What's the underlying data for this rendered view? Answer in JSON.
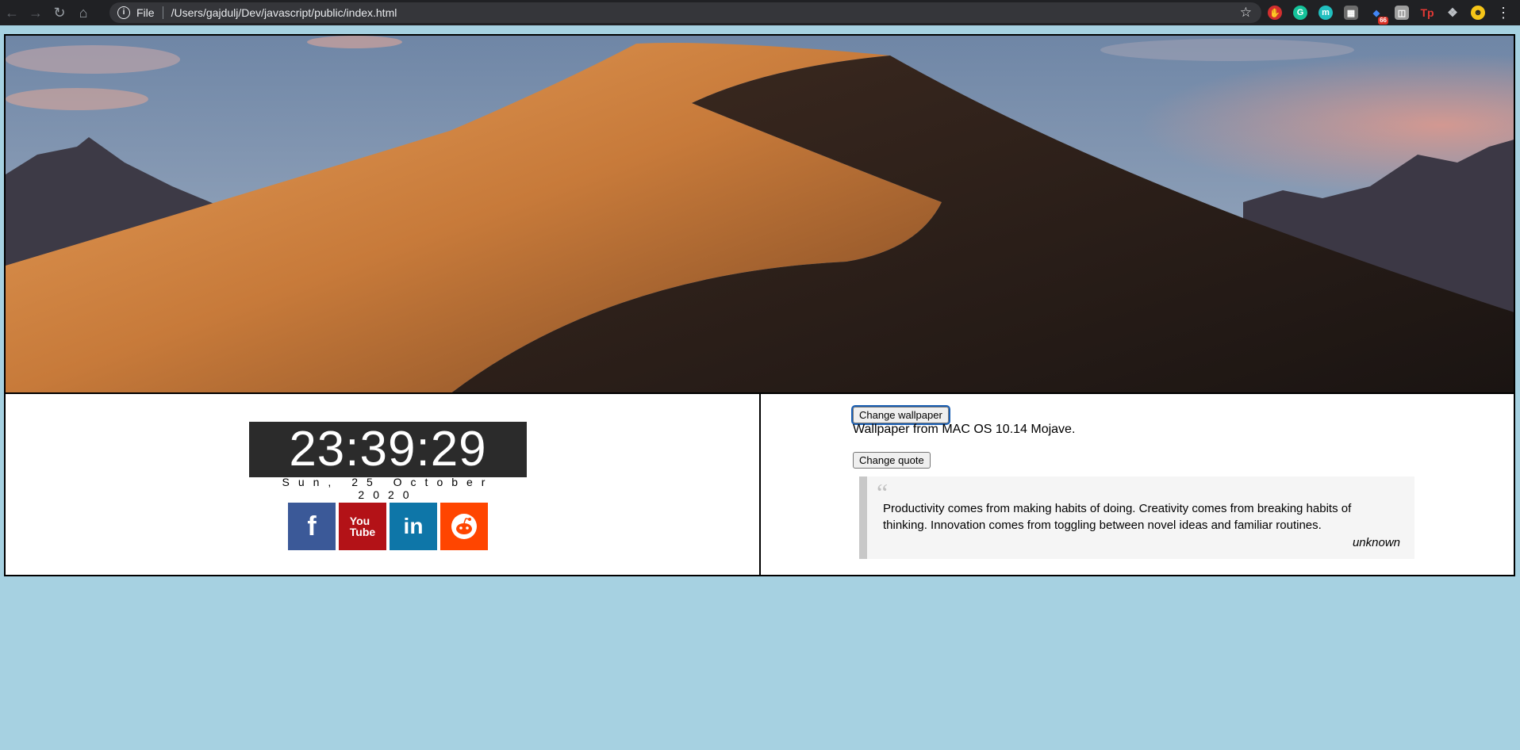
{
  "browser": {
    "file_label": "File",
    "url": "/Users/gajdulj/Dev/javascript/public/index.html",
    "extension_badge": "66"
  },
  "clock": {
    "time": "23:39:29",
    "date": "Sun, 25 October 2020"
  },
  "socials": [
    {
      "name": "facebook-icon",
      "color": "#3b5998"
    },
    {
      "name": "youtube-icon",
      "color": "#b31217",
      "label_top": "You",
      "label_bottom": "Tube"
    },
    {
      "name": "linkedin-icon",
      "color": "#0e76a8"
    },
    {
      "name": "reddit-icon",
      "color": "#ff4500"
    }
  ],
  "wallpaper": {
    "button_label": "Change wallpaper",
    "caption": "Wallpaper from MAC OS 10.14 Mojave."
  },
  "quote": {
    "button_label": "Change quote",
    "text": "Productivity comes from making habits of doing. Creativity comes from breaking habits of thinking. Innovation comes from toggling between novel ideas and familiar routines.",
    "author": "unknown"
  },
  "colors": {
    "page_background": "#a6d1e1",
    "chrome_background": "#202124"
  }
}
